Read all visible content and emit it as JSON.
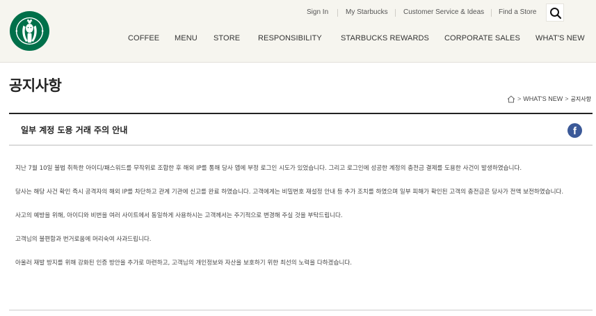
{
  "header": {
    "logo_alt": "Starbucks",
    "utility_links": [
      "Sign In",
      "My Starbucks",
      "Customer Service & Ideas",
      "Find a Store"
    ],
    "nav": [
      "COFFEE",
      "MENU",
      "STORE",
      "RESPONSIBILITY",
      "STARBUCKS REWARDS",
      "CORPORATE SALES",
      "WHAT'S NEW"
    ]
  },
  "page": {
    "title": "공지사항",
    "breadcrumb": [
      "WHAT'S NEW",
      "공지사항"
    ]
  },
  "notice": {
    "title": "일부 계정 도용 거래 주의 안내",
    "paragraphs": [
      "지난 7월 10일 불법 취득한 아이디/패스워드를 무작위로 조합한 후 해외 IP를 통해 당사 앱에 부정 로그인 시도가 있었습니다. 그리고 로그인에 성공한 계정의 충전금 결제를 도용한 사건이 발생하였습니다.",
      "당사는 해당 사건 확인 즉시 공격자의 해외 IP를 차단하고 관계 기관에 신고를 완료 하였습니다. 고객에게는 비밀번호 재설정 안내 등 추가 조치를 하였으며 일부 피해가 확인된 고객의 충전금은 당사가 전액 보전하였습니다.",
      "사고의 예방을 위해, 아이디와 비번을 여러 사이트에서 동일하게 사용하시는 고객께서는 주기적으로 변경해 주실 것을 부탁드립니다.",
      "고객님의 불편함과 번거로움에 머리숙여 사과드립니다.",
      "아울러 재발 방지를 위해 강화된 인증 방안을 추가로 마련하고, 고객님의 개인정보와 자산을 보호하기 위한 최선의 노력을 다하겠습니다."
    ]
  },
  "colors": {
    "header_bg": "#f6f5ef",
    "starbucks_green": "#00704a",
    "facebook_blue": "#3b5998"
  }
}
